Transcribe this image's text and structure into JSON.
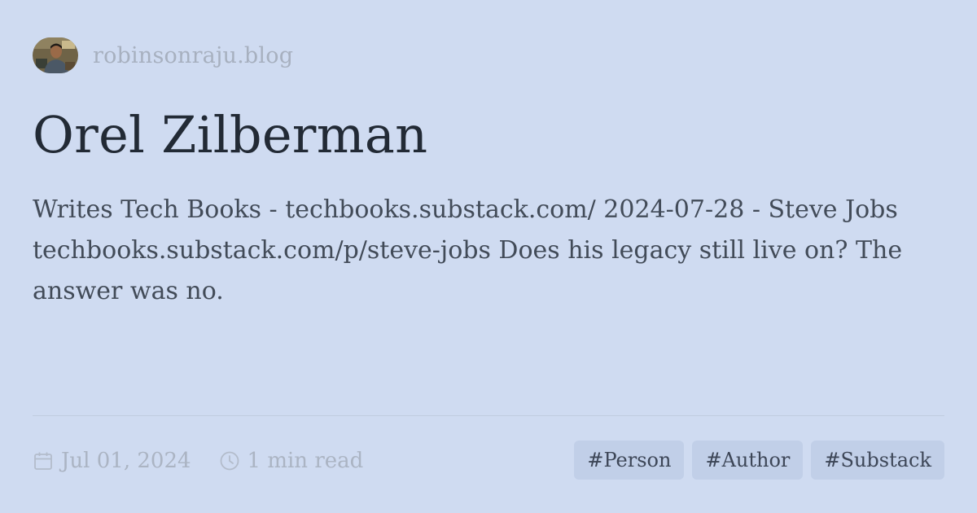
{
  "site": {
    "name": "robinsonraju.blog",
    "avatar_icon": "profile-photo"
  },
  "post": {
    "title": "Orel Zilberman",
    "description": "Writes Tech Books - techbooks.substack.com/ 2024-07-28 - Steve Jobs techbooks.substack.com/p/steve-jobs Does his legacy still live on? The answer was no."
  },
  "meta": {
    "date": "Jul 01, 2024",
    "date_icon": "calendar-icon",
    "read_time": "1 min read",
    "read_time_icon": "clock-icon"
  },
  "tags": [
    {
      "label": "#Person"
    },
    {
      "label": "#Author"
    },
    {
      "label": "#Substack"
    }
  ],
  "colors": {
    "background": "#cfdbf1",
    "title": "#222a35",
    "muted": "#a7b0bf",
    "tag_bg": "#c1cfe8"
  }
}
